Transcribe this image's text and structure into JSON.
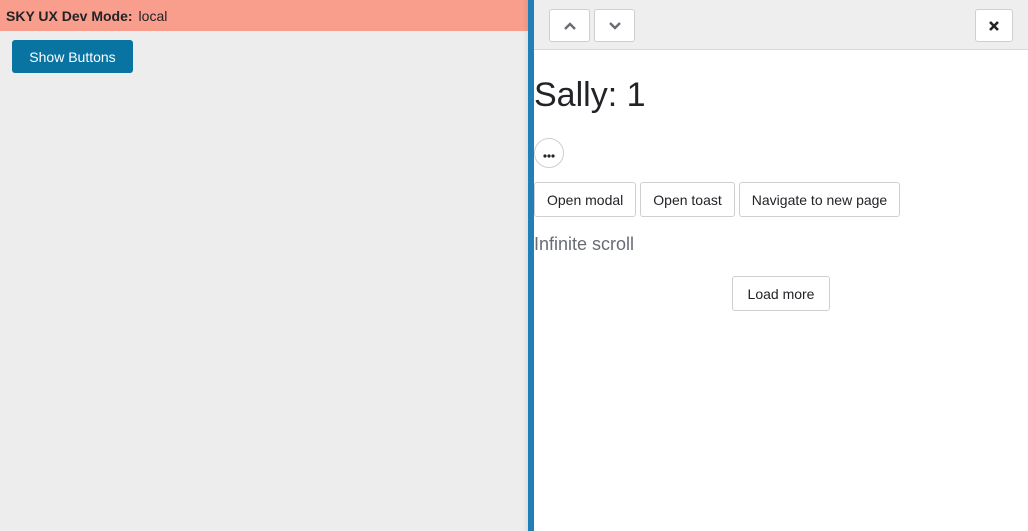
{
  "dev_banner": {
    "label": "SKY UX Dev Mode:",
    "value": "local"
  },
  "show_buttons_label": "Show Buttons",
  "flyout": {
    "header": {
      "prev_icon": "chevron-up-icon",
      "next_icon": "chevron-down-icon",
      "close_icon": "close-icon"
    },
    "title": "Sally: 1",
    "context_menu_icon": "ellipsis-icon",
    "actions": [
      {
        "label": "Open modal"
      },
      {
        "label": "Open toast"
      },
      {
        "label": "Navigate to new page"
      }
    ],
    "section_heading": "Infinite scroll",
    "load_more_label": "Load more"
  },
  "colors": {
    "banner": "#f99e8d",
    "primary": "#0974a1",
    "flyout_border": "#1f7fb6",
    "page_bg": "#ededed"
  }
}
